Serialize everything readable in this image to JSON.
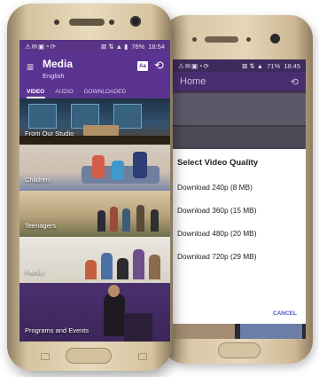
{
  "front": {
    "status": {
      "left_icons": "⚠✉▣◔⟳",
      "signal": "⊠ ⇅ ▲ ▮",
      "battery": "76%",
      "time": "18:54"
    },
    "appbar": {
      "menu_icon": "menu-icon",
      "title": "Media",
      "subtitle": "English",
      "language_icon_text": "Aa",
      "history_icon": "history-icon"
    },
    "tabs": [
      {
        "label": "VIDEO",
        "active": true
      },
      {
        "label": "AUDIO",
        "active": false
      },
      {
        "label": "DOWNLOADED",
        "active": false
      }
    ],
    "categories": [
      {
        "label": "From Our Studio"
      },
      {
        "label": "Children"
      },
      {
        "label": "Teenagers"
      },
      {
        "label": "Family"
      },
      {
        "label": "Programs and Events"
      }
    ]
  },
  "back": {
    "status": {
      "left_icons": "⚠✉▣◔⟳",
      "signal": "⊠ ⇅ ▲",
      "battery": "71%",
      "time": "18:45"
    },
    "appbar_title": "Home",
    "dialog": {
      "title": "Select Video Quality",
      "options": [
        "Download 240p (8 MB)",
        "Download 360p (15 MB)",
        "Download 480p (20 MB)",
        "Download 720p (29 MB)"
      ],
      "cancel": "CANCEL"
    }
  }
}
